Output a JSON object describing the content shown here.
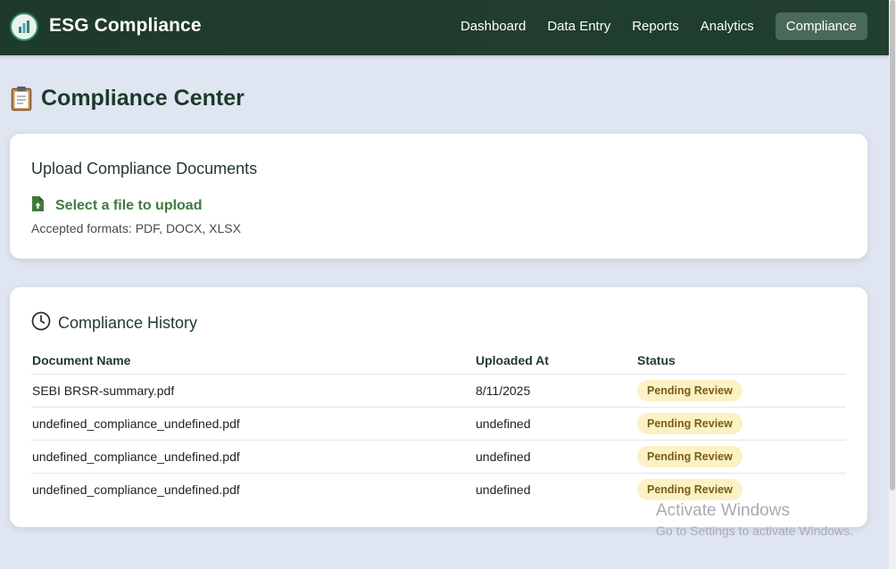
{
  "app": {
    "brand": "ESG Compliance",
    "logo_icon": "esg-leaf-chart-icon"
  },
  "nav": {
    "items": [
      {
        "label": "Dashboard"
      },
      {
        "label": "Data Entry"
      },
      {
        "label": "Reports"
      },
      {
        "label": "Analytics"
      },
      {
        "label": "Compliance",
        "active": true
      }
    ]
  },
  "page": {
    "title": "Compliance Center",
    "title_icon": "clipboard-icon"
  },
  "upload": {
    "title": "Upload Compliance Documents",
    "select_label": "Select a file to upload",
    "select_icon": "file-upload-icon",
    "accepted": "Accepted formats: PDF, DOCX, XLSX"
  },
  "history": {
    "title": "Compliance History",
    "icon": "clock-icon",
    "columns": [
      "Document Name",
      "Uploaded At",
      "Status"
    ],
    "rows": [
      {
        "name": "SEBI BRSR-summary.pdf",
        "uploaded": "8/11/2025",
        "status": "Pending Review"
      },
      {
        "name": "undefined_compliance_undefined.pdf",
        "uploaded": "undefined",
        "status": "Pending Review"
      },
      {
        "name": "undefined_compliance_undefined.pdf",
        "uploaded": "undefined",
        "status": "Pending Review"
      },
      {
        "name": "undefined_compliance_undefined.pdf",
        "uploaded": "undefined",
        "status": "Pending Review"
      }
    ]
  },
  "watermark": {
    "line1": "Activate Windows",
    "line2": "Go to Settings to activate Windows."
  },
  "colors": {
    "topbar": "#1e3a2c",
    "accent_green": "#3f7a3f",
    "badge_bg": "#fbf1c4",
    "badge_text": "#7a5d13",
    "page_bg": "#dfe5f1"
  }
}
